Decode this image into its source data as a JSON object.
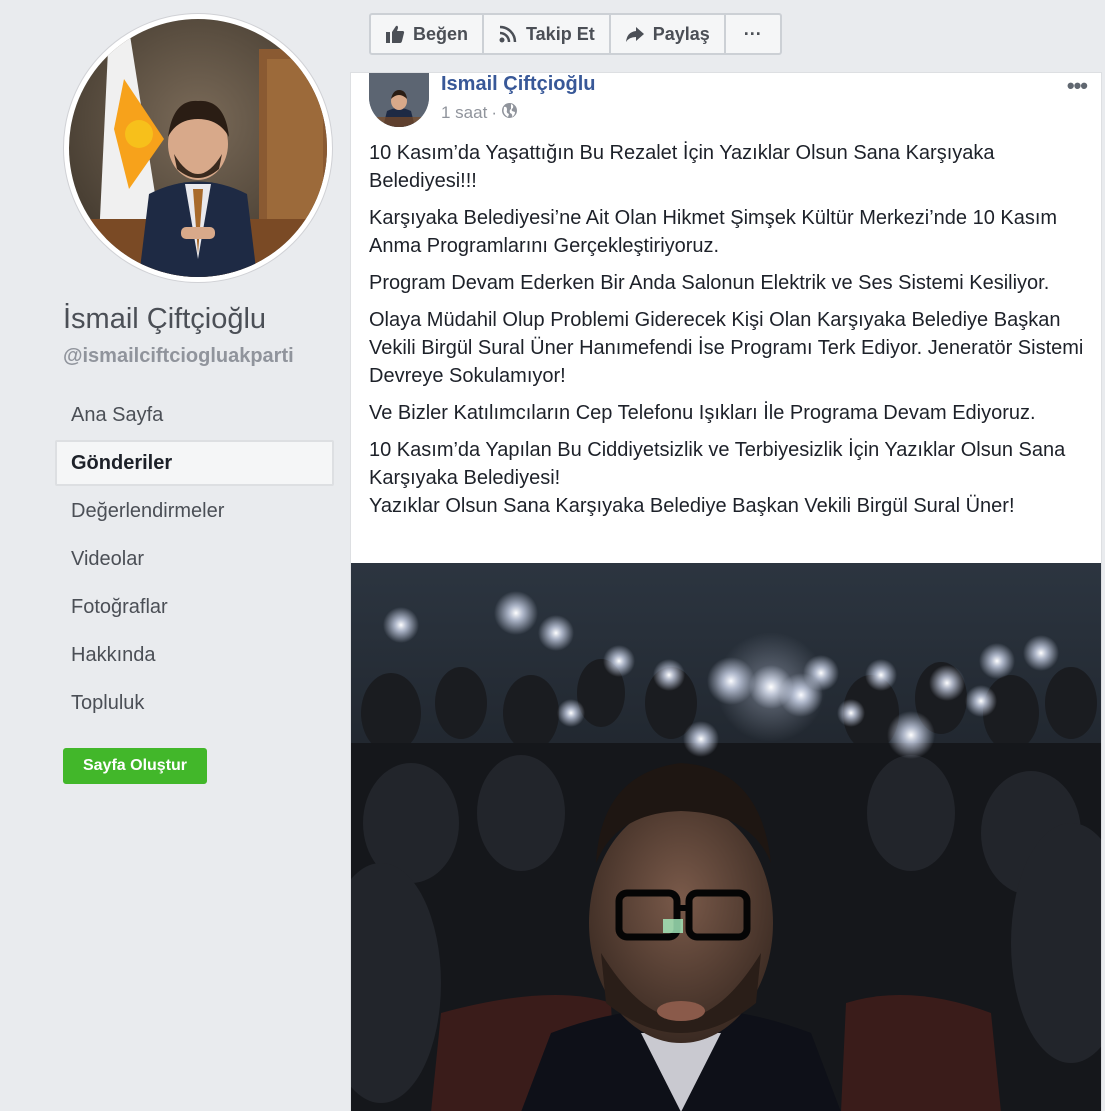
{
  "sidebar": {
    "page_name": "İsmail Çiftçioğlu",
    "handle": "@ismailciftciogluakparti",
    "nav": [
      {
        "label": "Ana Sayfa",
        "active": false
      },
      {
        "label": "Gönderiler",
        "active": true
      },
      {
        "label": "Değerlendirmeler",
        "active": false
      },
      {
        "label": "Videolar",
        "active": false
      },
      {
        "label": "Fotoğraflar",
        "active": false
      },
      {
        "label": "Hakkında",
        "active": false
      },
      {
        "label": "Topluluk",
        "active": false
      }
    ],
    "create_page_label": "Sayfa Oluştur"
  },
  "action_bar": {
    "like_label": "Beğen",
    "follow_label": "Takip Et",
    "share_label": "Paylaş",
    "more_label": "···"
  },
  "post": {
    "author": "Ismail Çiftçioğlu",
    "time": "1 saat",
    "separator": "·",
    "menu_label": "•••",
    "paragraphs": [
      "10 Kasım’da Yaşattığın Bu Rezalet İçin Yazıklar Olsun Sana Karşıyaka Belediyesi!!!",
      "Karşıyaka Belediyesi’ne Ait Olan Hikmet Şimşek Kültür Merkezi’nde 10 Kasım Anma Programlarını Gerçekleştiriyoruz.",
      "Program Devam Ederken Bir Anda Salonun Elektrik ve Ses Sistemi Kesiliyor.",
      "Olaya Müdahil Olup Problemi Giderecek Kişi Olan Karşıyaka Belediye Başkan Vekili Birgül Sural Üner Hanımefendi İse Programı Terk Ediyor. Jeneratör Sistemi Devreye Sokulamıyor!",
      "Ve Bizler Katılımcıların Cep Telefonu Işıkları İle Programa Devam Ediyoruz."
    ],
    "closing_line_1": "10 Kasım’da Yapılan Bu Ciddiyetsizlik ve Terbiyesizlik İçin Yazıklar Olsun Sana Karşıyaka Belediyesi!",
    "closing_line_2": "Yazıklar Olsun Sana Karşıyaka Belediye Başkan Vekili Birgül Sural Üner!"
  },
  "colors": {
    "background": "#e9ebee",
    "link_blue": "#385898",
    "green_button": "#42b72a",
    "text": "#1d2129",
    "muted": "#90949c"
  },
  "icons": [
    "thumbs-up-icon",
    "rss-icon",
    "share-arrow-icon",
    "globe-icon",
    "more-dots-icon"
  ]
}
